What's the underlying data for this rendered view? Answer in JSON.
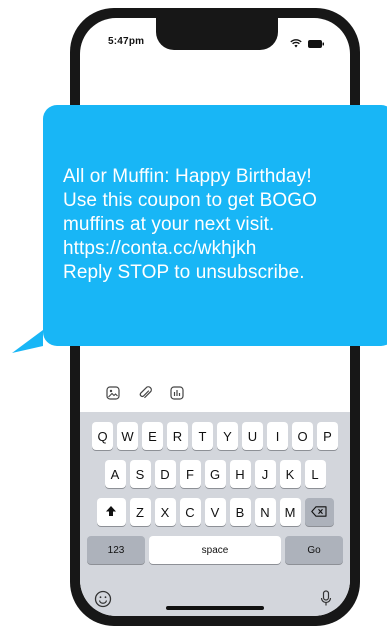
{
  "status_bar": {
    "time": "5:47pm",
    "icons": [
      "wifi-icon",
      "battery-icon"
    ]
  },
  "message": {
    "lines": [
      "All or Muffin: Happy Birthday!",
      "Use this coupon to get BOGO",
      "muffins at your next visit.",
      "https://conta.cc/wkhjkh",
      "Reply STOP to unsubscribe."
    ],
    "bubble_color": "#18b6f6",
    "text_color": "#ffffff"
  },
  "composer_tools": [
    "image-icon",
    "attachment-icon",
    "poll-icon"
  ],
  "keyboard": {
    "row1": [
      "Q",
      "W",
      "E",
      "R",
      "T",
      "Y",
      "U",
      "I",
      "O",
      "P"
    ],
    "row2": [
      "A",
      "S",
      "D",
      "F",
      "G",
      "H",
      "J",
      "K",
      "L"
    ],
    "row3": [
      "Z",
      "X",
      "C",
      "V",
      "B",
      "N",
      "M"
    ],
    "numbers_key": "123",
    "space_key": "space",
    "go_key": "Go",
    "icons": [
      "shift-icon",
      "backspace-icon",
      "emoji-icon",
      "microphone-icon"
    ]
  }
}
